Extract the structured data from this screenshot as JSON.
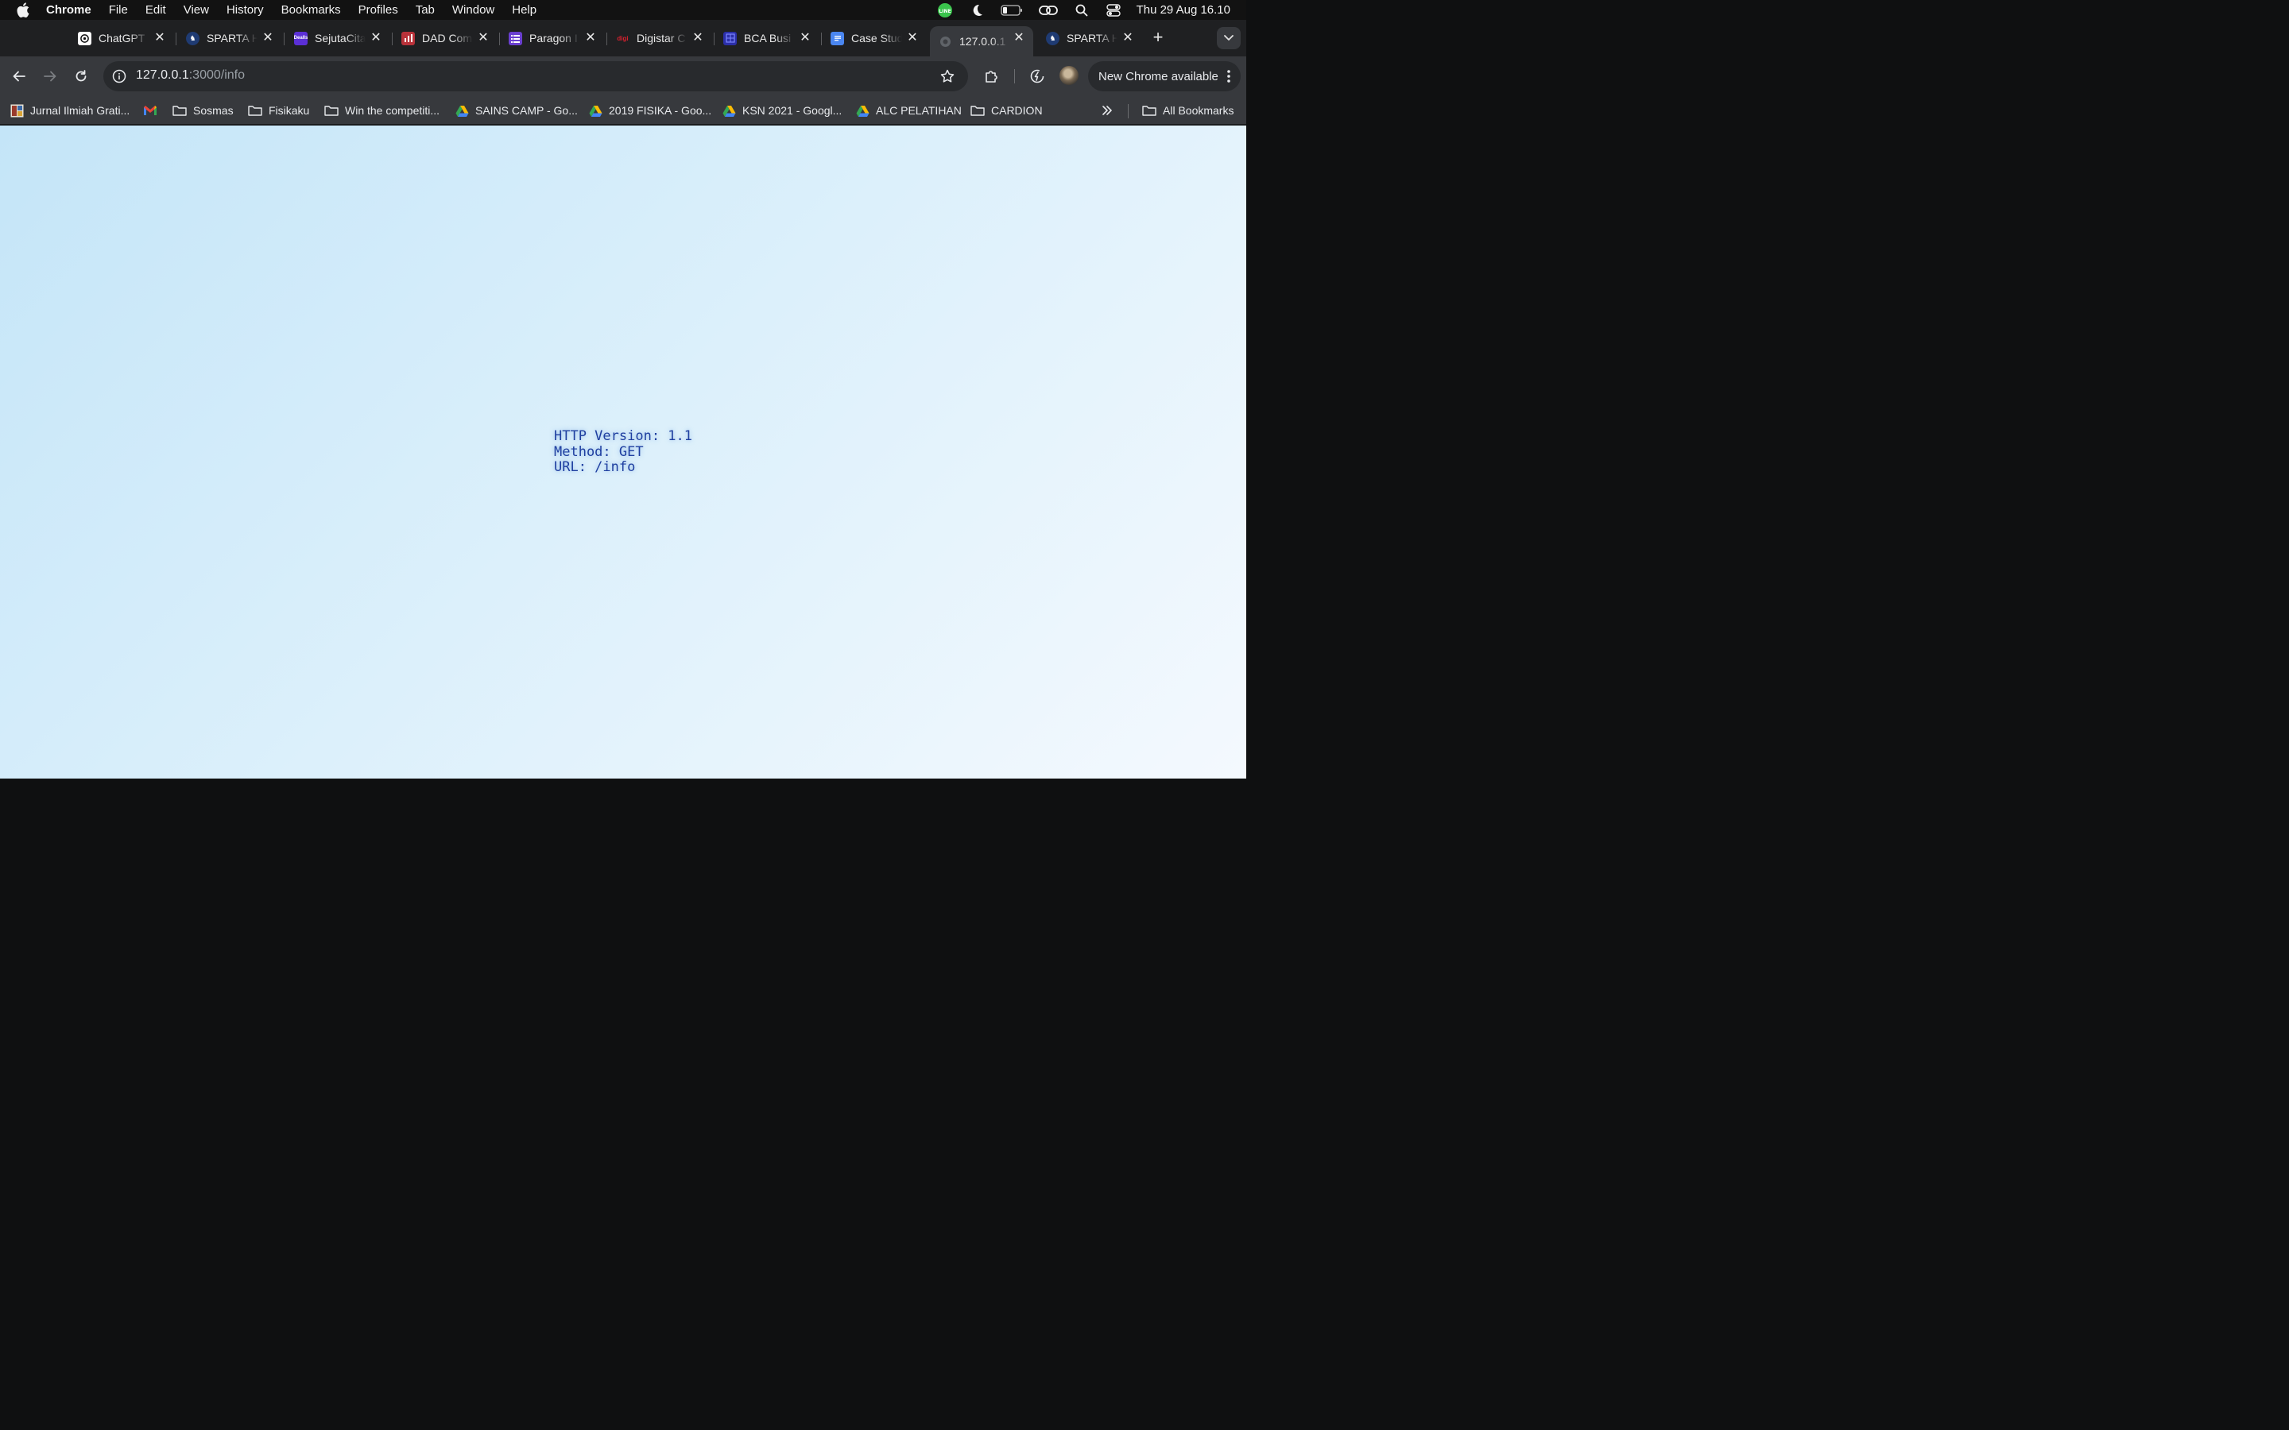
{
  "menubar": {
    "app_name": "Chrome",
    "items": [
      "File",
      "Edit",
      "View",
      "History",
      "Bookmarks",
      "Profiles",
      "Tab",
      "Window",
      "Help"
    ],
    "clock": "Thu 29 Aug  16.10",
    "status_icons": [
      "line-icon",
      "moon-icon",
      "battery-icon",
      "link-icon",
      "search-icon",
      "control-center-icon"
    ]
  },
  "tabs": [
    {
      "title": "ChatGPT",
      "icon": "chatgpt-icon",
      "color": "#ffffff"
    },
    {
      "title": "SPARTA H",
      "icon": "sparta-icon",
      "color": "#1f3b73"
    },
    {
      "title": "SejutaCita",
      "icon": "sejutacita-icon",
      "color": "#5b2fd6"
    },
    {
      "title": "DAD Com",
      "icon": "dad-icon",
      "color": "#b8323a"
    },
    {
      "title": "Paragon I",
      "icon": "paragon-icon",
      "color": "#6a3fd0"
    },
    {
      "title": "Digistar C",
      "icon": "digistar-icon",
      "color": "#d8202e"
    },
    {
      "title": "BCA Busi",
      "icon": "bca-icon",
      "color": "#2b2fa8"
    },
    {
      "title": "Case Stud",
      "icon": "docs-icon",
      "color": "#4a86f0"
    },
    {
      "title": "127.0.0.1",
      "icon": "globe-icon",
      "color": "#5f6368",
      "active": true
    },
    {
      "title": "SPARTA H",
      "icon": "sparta-icon",
      "color": "#1f3b73"
    }
  ],
  "toolbar": {
    "url_host": "127.0.0.1",
    "url_rest": ":3000/info",
    "update_label": "New Chrome available"
  },
  "bookmarks": [
    {
      "label": "Jurnal Ilmiah Grati...",
      "icon": "jurnal-icon"
    },
    {
      "label": "",
      "icon": "gmail-icon"
    },
    {
      "label": "Sosmas",
      "icon": "folder-icon"
    },
    {
      "label": "Fisikaku",
      "icon": "folder-icon"
    },
    {
      "label": "Win the competiti...",
      "icon": "folder-icon"
    },
    {
      "label": "SAINS CAMP - Go...",
      "icon": "drive-icon"
    },
    {
      "label": "2019 FISIKA - Goo...",
      "icon": "drive-icon"
    },
    {
      "label": "KSN 2021 - Googl...",
      "icon": "drive-icon"
    },
    {
      "label": "ALC PELATIHAN",
      "icon": "drive-icon"
    },
    {
      "label": "CARDION",
      "icon": "folder-icon"
    }
  ],
  "all_bookmarks_label": "All Bookmarks",
  "content": {
    "lines": [
      "HTTP Version: 1.1",
      "Method: GET",
      "URL: /info"
    ],
    "text_color": "#1f3fa0"
  }
}
